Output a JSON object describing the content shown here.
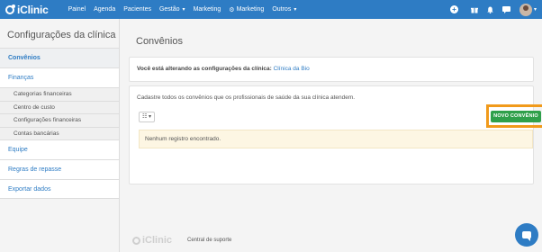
{
  "brand": {
    "name": "iClinic"
  },
  "nav": {
    "items": [
      {
        "label": "Painel"
      },
      {
        "label": "Agenda"
      },
      {
        "label": "Pacientes"
      },
      {
        "label": "Gestão",
        "chevron": "▾"
      },
      {
        "label": "Marketing"
      },
      {
        "label": "Marketing",
        "icon": "gear-icon"
      },
      {
        "label": "Outros",
        "chevron": "▾"
      }
    ]
  },
  "sidebar": {
    "title": "Configurações da clínica",
    "items": [
      {
        "label": "Convênios",
        "active": true
      },
      {
        "label": "Finanças"
      }
    ],
    "subitems": [
      {
        "label": "Categorias financeiras"
      },
      {
        "label": "Centro de custo"
      },
      {
        "label": "Configurações financeiras"
      },
      {
        "label": "Contas bancárias"
      }
    ],
    "items_after": [
      {
        "label": "Equipe"
      },
      {
        "label": "Regras de repasse"
      },
      {
        "label": "Exportar dados"
      }
    ]
  },
  "main": {
    "title": "Convênios",
    "altering_text": "Você está alterando as configurações da clínica:",
    "clinic_name": "Clínica da Bio",
    "description": "Cadastre todos os convênios que os profissionais de saúde da sua clínica atendem.",
    "filter_label": "☷ ▾",
    "new_button": "NOVO CONVÊNIO",
    "empty_message": "Nenhum registro encontrado."
  },
  "footer": {
    "logo": "iClinic",
    "support": "Central de suporte"
  },
  "colors": {
    "primary": "#2e7cc4",
    "success": "#2fa04b",
    "highlight": "#f19a1b",
    "warning_bg": "#fdf6e3"
  }
}
